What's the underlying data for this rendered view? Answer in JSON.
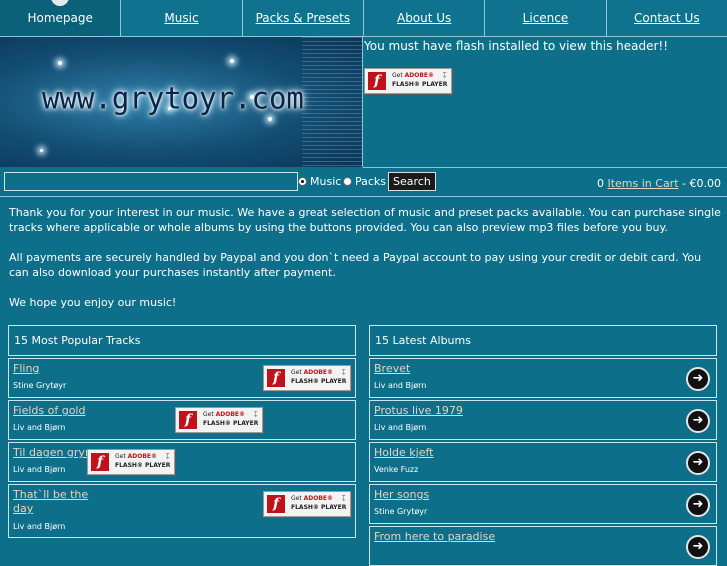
{
  "nav": {
    "items": [
      {
        "label": "Homepage"
      },
      {
        "label": "Music"
      },
      {
        "label": "Packs & Presets"
      },
      {
        "label": "About Us"
      },
      {
        "label": "Licence"
      },
      {
        "label": "Contact Us"
      }
    ]
  },
  "header": {
    "logo_text": "www.grytoyr.com",
    "flash_message": "You must have flash installed to view this header!!"
  },
  "flash_badge": {
    "line1_prefix": "Get ",
    "line1_brand": "ADOBE®",
    "line2": "FLASH® PLAYER",
    "logo_glyph": "f"
  },
  "search": {
    "value": "",
    "option_music": "Music",
    "option_packs": "Packs",
    "selected": "Music",
    "button": "Search"
  },
  "cart": {
    "count": "0",
    "link": "Items in Cart",
    "total": "- €0.00"
  },
  "intro": {
    "p1": "Thank you for your interest in our music. We have a great selection of music and preset packs available. You can purchase single tracks where applicable or whole albums by using the buttons provided. You can also preview mp3 files before you buy.",
    "p2": "All payments are securely handled by Paypal and you don`t need a Paypal account to pay using your credit or debit card. You can also download your purchases instantly after payment.",
    "p3": "We hope you enjoy our music!"
  },
  "popular": {
    "title": "15 Most Popular Tracks",
    "tracks": [
      {
        "title": "Fling",
        "artist": "Stine Grytøyr"
      },
      {
        "title": "Fields of gold",
        "artist": "Liv and Bjørn"
      },
      {
        "title": "Til dagen gryr",
        "artist": "Liv and Bjørn"
      },
      {
        "title": "That`ll be the day",
        "artist": "Liv and Bjørn"
      }
    ]
  },
  "latest": {
    "title": "15 Latest Albums",
    "albums": [
      {
        "title": "Brevet",
        "artist": "Liv and Bjørn"
      },
      {
        "title": "Protus live 1979",
        "artist": "Liv and Bjørn"
      },
      {
        "title": "Holde kjeft",
        "artist": "Venke Fuzz"
      },
      {
        "title": "Her songs",
        "artist": "Stine Grytøyr"
      },
      {
        "title": "From here to paradise",
        "artist": ""
      }
    ]
  },
  "icons": {
    "arrow": "arrow-right-icon",
    "flash": "flash-player-icon"
  }
}
